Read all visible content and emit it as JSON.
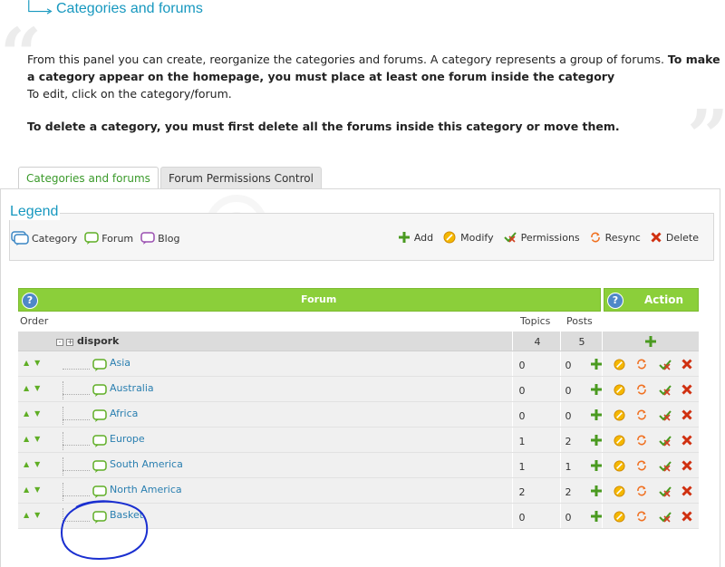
{
  "page": {
    "title": "Categories and forums",
    "intro_line1": "From this panel you can create, reorganize the categories and forums. A category represents a group of forums. ",
    "intro_line1_bold": "To make a category appear on the homepage, you must place at least one forum inside the category",
    "intro_line2": "To edit, click on the category/forum.",
    "intro_line3": "To delete a category, you must first delete all the forums inside this category or move them."
  },
  "tabs": [
    {
      "label": "Categories and forums",
      "active": true
    },
    {
      "label": "Forum Permissions Control",
      "active": false
    }
  ],
  "legend": {
    "title": "Legend",
    "types": [
      {
        "label": "Category",
        "icon": "category-icon"
      },
      {
        "label": "Forum",
        "icon": "forum-icon"
      },
      {
        "label": "Blog",
        "icon": "blog-icon"
      }
    ],
    "actions": [
      {
        "label": "Add",
        "icon": "add-icon"
      },
      {
        "label": "Modify",
        "icon": "modify-icon"
      },
      {
        "label": "Permissions",
        "icon": "permissions-icon"
      },
      {
        "label": "Resync",
        "icon": "resync-icon"
      },
      {
        "label": "Delete",
        "icon": "delete-icon"
      }
    ]
  },
  "table": {
    "header_forum": "Forum",
    "header_action": "Action",
    "help_symbol": "?",
    "col_order": "Order",
    "col_topics": "Topics",
    "col_posts": "Posts",
    "category": {
      "name": "dispork",
      "topics": "4",
      "posts": "5"
    },
    "forums": [
      {
        "name": "Asia",
        "topics": "0",
        "posts": "0"
      },
      {
        "name": "Australia",
        "topics": "0",
        "posts": "0"
      },
      {
        "name": "Africa",
        "topics": "0",
        "posts": "0"
      },
      {
        "name": "Europe",
        "topics": "1",
        "posts": "2"
      },
      {
        "name": "South America",
        "topics": "1",
        "posts": "1"
      },
      {
        "name": "North America",
        "topics": "2",
        "posts": "2"
      },
      {
        "name": "Basket",
        "topics": "0",
        "posts": "0"
      }
    ]
  },
  "colors": {
    "accent": "#1798bf",
    "header_green": "#8bcf3a",
    "link": "#2a7fb0",
    "annotation": "#1a2fd0"
  }
}
